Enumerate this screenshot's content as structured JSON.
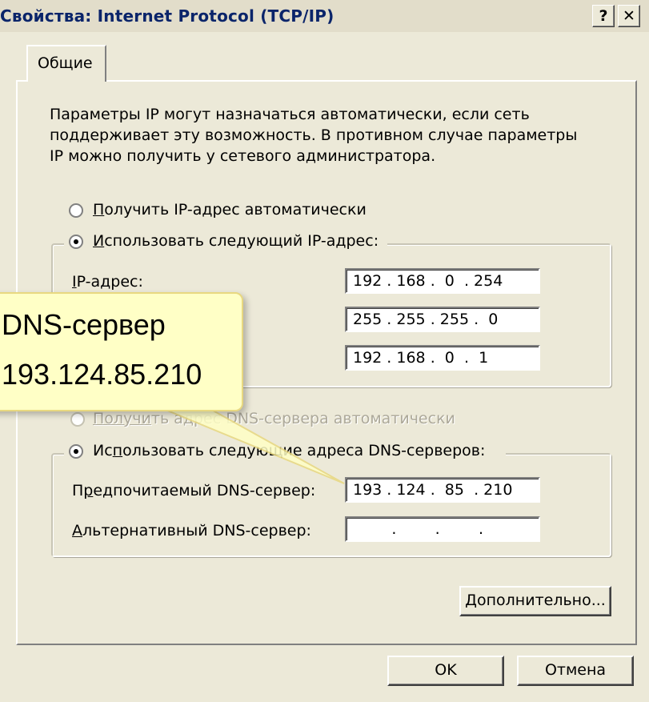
{
  "window": {
    "title": "Свойства: Internet Protocol (TCP/IP)",
    "help_btn": "?",
    "close_btn": "✕"
  },
  "tab": {
    "label": "Общие"
  },
  "intro": [
    "Параметры IP могут назначаться автоматически, если сеть",
    "поддерживает эту возможность. В противном случае параметры",
    "IP можно получить у сетевого администратора."
  ],
  "ip": {
    "auto_first": "П",
    "auto_rest": "олучить IP-адрес автоматически",
    "manual_first": "И",
    "manual_rest": "спользовать следующий IP-адрес:",
    "address_label_first": "I",
    "address_label_rest": "P-адрес:",
    "address_value": "192 . 168 .  0  . 254",
    "mask_value": "255 . 255 . 255 .  0",
    "gateway_value": "192 . 168 .  0  .  1",
    "selected": "manual"
  },
  "dns": {
    "auto_first": "Получи",
    "auto_rest": "ть адрес DNS-сервера автоматически",
    "manual_a": "Ис",
    "manual_b": "п",
    "manual_c": "ользовать следующие адреса DNS-серверов:",
    "preferred_label_a": "П",
    "preferred_label_b": "р",
    "preferred_label_c": "едпочитаемый DNS-сервер:",
    "preferred_value": "193 . 124 .  85  . 210",
    "alternate_label_first": "А",
    "alternate_label_rest": "льтернативный DNS-сервер:",
    "alternate_value": "        .        .        .",
    "selected": "manual"
  },
  "buttons": {
    "advanced_first": "Д",
    "advanced_rest": "ополнительно...",
    "ok": "OK",
    "cancel": "Отмена"
  },
  "callout": {
    "line1": "DNS-сервер",
    "line2": "193.124.85.210"
  }
}
